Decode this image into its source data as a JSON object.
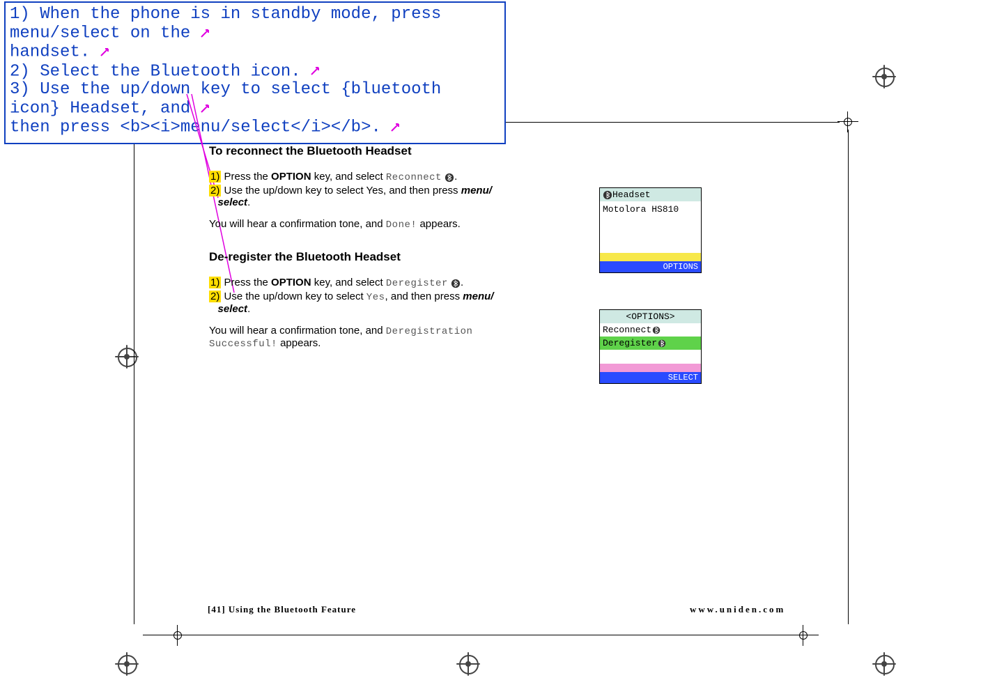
{
  "annotation": {
    "line1": "1) When the phone is in standby mode, press menu/select on the ",
    "line1b": "handset.",
    "line2": "2) Select the Bluetooth icon.",
    "line3a": "3) Use the up/down key to select {bluetooth icon} Headset, and ",
    "line3b": "then press <b><i>menu/select</i></b>."
  },
  "section1": {
    "title": "To reconnect the Bluetooth Headset",
    "step1_num": "1)",
    "step1_a": " Press the ",
    "step1_key": "OPTION",
    "step1_b": " key, and select ",
    "step1_pix": "Reconnect",
    "step1_dot": ".",
    "step2_num": "2)",
    "step2_a": " Use the up/down key to select Yes, and then press ",
    "step2_ms": "menu/",
    "step2_ms2": "select",
    "step2_dot": ".",
    "note_a": "You will hear a confirmation tone, and ",
    "note_pix": "Done!",
    "note_b": " appears."
  },
  "section2": {
    "title": "De-register the Bluetooth Headset",
    "step1_num": "1)",
    "step1_a": " Press the ",
    "step1_key": "OPTION",
    "step1_b": " key, and select ",
    "step1_pix": "Deregister",
    "step1_dot": ".",
    "step2_num": "2)",
    "step2_a": " Use the up/down key to select ",
    "step2_pix": "Yes",
    "step2_b": ", and then press ",
    "step2_ms": "menu/",
    "step2_ms2": "select",
    "step2_dot": ".",
    "note_a": "You will hear a confirmation tone, and ",
    "note_pix": "Deregistration",
    "note_pix2": "Successful!",
    "note_b": " appears."
  },
  "screen1": {
    "top_icon": "B",
    "top_text": "Headset",
    "body1": "Motolora HS810",
    "foot": "OPTIONS"
  },
  "screen2": {
    "top_text": "<OPTIONS>",
    "row1": "Reconnect",
    "row2": "Deregister",
    "foot": "SELECT"
  },
  "footer": {
    "left_page": "[41]",
    "left_text": " Using the Bluetooth Feature",
    "right": "www.uniden.com"
  }
}
